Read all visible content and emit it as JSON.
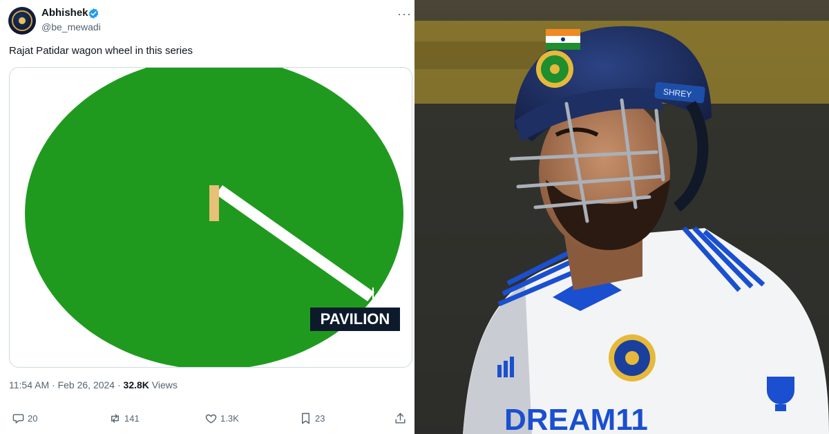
{
  "tweet": {
    "author": {
      "name": "Abhishek",
      "handle": "@be_mewadi",
      "verified": true
    },
    "text": "Rajat Patidar wagon wheel in this series",
    "media": {
      "label": "PAVILION"
    },
    "meta": {
      "time": "11:54 AM",
      "separator": "·",
      "date": "Feb 26, 2024",
      "separator2": "·",
      "views": "32.8K",
      "views_label": "Views"
    },
    "actions": {
      "replies": "20",
      "reposts": "141",
      "likes": "1.3K",
      "bookmarks": "23"
    },
    "icons": {
      "reply": "comment-icon",
      "repost": "repost-icon",
      "like": "heart-icon",
      "bookmark": "bookmark-icon",
      "share": "share-icon",
      "more": "more-icon"
    }
  },
  "photo": {
    "helmet_name": "SHREY",
    "jersey_text": "DREAM11"
  },
  "colors": {
    "field_green": "#1f9a1f",
    "pitch": "#e8c077",
    "label_bg": "#0d1a2b",
    "helmet": "#1d2f63"
  }
}
